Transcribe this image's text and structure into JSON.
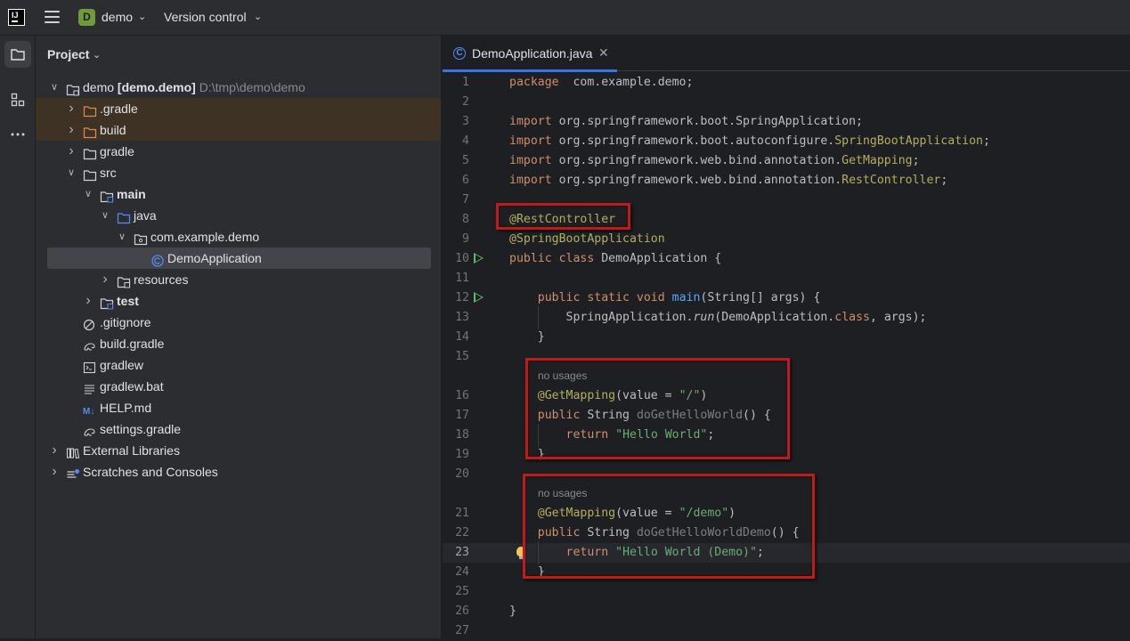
{
  "titlebar": {
    "project_badge": "D",
    "project_name": "demo",
    "vcs_label": "Version control"
  },
  "project_panel": {
    "header": "Project",
    "tree": [
      {
        "id": "root",
        "label": "demo",
        "bold_suffix": "[demo.demo]",
        "path": "D:\\tmp\\demo\\demo",
        "level": 0,
        "expanded": true,
        "icon": "module-folder-icon"
      },
      {
        "id": "gradle-hidden",
        "label": ".gradle",
        "level": 1,
        "expanded": false,
        "icon": "excluded-folder-icon",
        "excluded": true
      },
      {
        "id": "build",
        "label": "build",
        "level": 1,
        "expanded": false,
        "icon": "excluded-folder-icon",
        "excluded": true
      },
      {
        "id": "gradle",
        "label": "gradle",
        "level": 1,
        "expanded": false,
        "icon": "folder-icon"
      },
      {
        "id": "src",
        "label": "src",
        "level": 1,
        "expanded": true,
        "icon": "folder-icon"
      },
      {
        "id": "main",
        "label": "main",
        "level": 2,
        "expanded": true,
        "icon": "source-root-folder-icon",
        "bold": true
      },
      {
        "id": "java",
        "label": "java",
        "level": 3,
        "expanded": true,
        "icon": "source-folder-icon"
      },
      {
        "id": "package",
        "label": "com.example.demo",
        "level": 4,
        "expanded": true,
        "icon": "package-icon"
      },
      {
        "id": "DemoApplication",
        "label": "DemoApplication",
        "level": 5,
        "icon": "class-icon",
        "selected": true
      },
      {
        "id": "resources",
        "label": "resources",
        "level": 3,
        "expanded": false,
        "icon": "resources-folder-icon"
      },
      {
        "id": "test",
        "label": "test",
        "level": 2,
        "expanded": false,
        "icon": "source-root-folder-icon",
        "bold": true
      },
      {
        "id": "gitignore",
        "label": ".gitignore",
        "level": 1,
        "icon": "ignore-file-icon"
      },
      {
        "id": "build-gradle",
        "label": "build.gradle",
        "level": 1,
        "icon": "gradle-file-icon"
      },
      {
        "id": "gradlew",
        "label": "gradlew",
        "level": 1,
        "icon": "shell-script-icon"
      },
      {
        "id": "gradlew-bat",
        "label": "gradlew.bat",
        "level": 1,
        "icon": "text-file-icon"
      },
      {
        "id": "help-md",
        "label": "HELP.md",
        "level": 1,
        "icon": "markdown-icon"
      },
      {
        "id": "settings-gradle",
        "label": "settings.gradle",
        "level": 1,
        "icon": "gradle-file-icon"
      },
      {
        "id": "external-libraries",
        "label": "External Libraries",
        "level": 0,
        "expanded": false,
        "icon": "libraries-icon"
      },
      {
        "id": "scratches",
        "label": "Scratches and Consoles",
        "level": 0,
        "expanded": false,
        "icon": "scratches-icon"
      }
    ]
  },
  "editor": {
    "tab_label": "DemoApplication.java",
    "hint_no_usages": "no usages",
    "lines": [
      {
        "n": "1",
        "tokens": [
          [
            "kw",
            "package"
          ],
          [
            "",
            "  com.example.demo;"
          ]
        ]
      },
      {
        "n": "2",
        "tokens": []
      },
      {
        "n": "3",
        "tokens": [
          [
            "kw",
            "import"
          ],
          [
            "",
            " org.springframework.boot.SpringApplication;"
          ]
        ]
      },
      {
        "n": "4",
        "tokens": [
          [
            "kw",
            "import"
          ],
          [
            "",
            " org.springframework.boot.autoconfigure."
          ],
          [
            "ann",
            "SpringBootApplication"
          ],
          [
            "",
            ";"
          ]
        ]
      },
      {
        "n": "5",
        "tokens": [
          [
            "kw",
            "import"
          ],
          [
            "",
            " org.springframework.web.bind.annotation."
          ],
          [
            "ann",
            "GetMapping"
          ],
          [
            "",
            ";"
          ]
        ]
      },
      {
        "n": "6",
        "tokens": [
          [
            "kw",
            "import"
          ],
          [
            "",
            " org.springframework.web.bind.annotation."
          ],
          [
            "ann",
            "RestController"
          ],
          [
            "",
            ";"
          ]
        ]
      },
      {
        "n": "7",
        "tokens": []
      },
      {
        "n": "8",
        "tokens": [
          [
            "ann",
            "@RestController"
          ]
        ]
      },
      {
        "n": "9",
        "tokens": [
          [
            "ann",
            "@SpringBootApplication"
          ]
        ]
      },
      {
        "n": "10",
        "run": true,
        "tokens": [
          [
            "kw",
            "public class"
          ],
          [
            "",
            " DemoApplication {"
          ]
        ]
      },
      {
        "n": "11",
        "tokens": []
      },
      {
        "n": "12",
        "run": true,
        "tokens": [
          [
            "",
            "    "
          ],
          [
            "kw",
            "public static void"
          ],
          [
            "",
            " "
          ],
          [
            "fn",
            "main"
          ],
          [
            "",
            "(String[] args) {"
          ]
        ]
      },
      {
        "n": "13",
        "tokens": [
          [
            "",
            "        SpringApplication."
          ],
          [
            "it",
            "run"
          ],
          [
            "",
            "(DemoApplication."
          ],
          [
            "kw",
            "class"
          ],
          [
            "",
            ", args);"
          ]
        ]
      },
      {
        "n": "14",
        "tokens": [
          [
            "",
            "    }"
          ]
        ]
      },
      {
        "n": "15",
        "tokens": []
      },
      {
        "n": "16",
        "hint": true,
        "tokens": [
          [
            "",
            "    "
          ],
          [
            "ann",
            "@GetMapping"
          ],
          [
            "",
            "(value = "
          ],
          [
            "str",
            "\"/\""
          ],
          [
            "",
            ")"
          ]
        ]
      },
      {
        "n": "17",
        "tokens": [
          [
            "",
            "    "
          ],
          [
            "kw",
            "public"
          ],
          [
            "",
            " String "
          ],
          [
            "unused",
            "doGetHelloWorld"
          ],
          [
            "",
            "() {"
          ]
        ]
      },
      {
        "n": "18",
        "tokens": [
          [
            "",
            "        "
          ],
          [
            "kw",
            "return"
          ],
          [
            "",
            " "
          ],
          [
            "str",
            "\"Hello World\""
          ],
          [
            "",
            ";"
          ]
        ]
      },
      {
        "n": "19",
        "tokens": [
          [
            "",
            "    }"
          ]
        ]
      },
      {
        "n": "20",
        "tokens": []
      },
      {
        "n": "21",
        "hint": true,
        "tokens": [
          [
            "",
            "    "
          ],
          [
            "ann",
            "@GetMapping"
          ],
          [
            "",
            "(value = "
          ],
          [
            "str",
            "\"/demo\""
          ],
          [
            "",
            ")"
          ]
        ]
      },
      {
        "n": "22",
        "tokens": [
          [
            "",
            "    "
          ],
          [
            "kw",
            "public"
          ],
          [
            "",
            " String "
          ],
          [
            "unused",
            "doGetHelloWorldDemo"
          ],
          [
            "",
            "() {"
          ]
        ]
      },
      {
        "n": "23",
        "current": true,
        "bulb": true,
        "tokens": [
          [
            "",
            "        "
          ],
          [
            "kw",
            "return"
          ],
          [
            "",
            " "
          ],
          [
            "str",
            "\"Hello World (Demo)\""
          ],
          [
            "",
            ";"
          ]
        ]
      },
      {
        "n": "24",
        "tokens": [
          [
            "",
            "    }"
          ]
        ]
      },
      {
        "n": "25",
        "tokens": []
      },
      {
        "n": "26",
        "tokens": [
          [
            "",
            "}"
          ]
        ]
      },
      {
        "n": "27",
        "tokens": []
      }
    ]
  },
  "colors": {
    "accent": "#3574f0",
    "highlight_box": "#c21a1a",
    "excluded_row": "#3d3223",
    "keyword": "#cf8e6d",
    "annotation": "#b3ae60",
    "string": "#6aab73"
  }
}
